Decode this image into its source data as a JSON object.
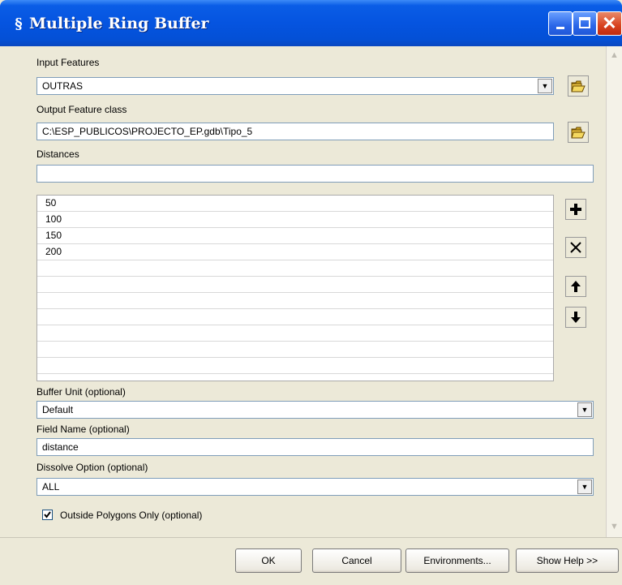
{
  "window": {
    "title": "Multiple Ring Buffer"
  },
  "form": {
    "input_features": {
      "label": "Input Features",
      "value": "OUTRAS"
    },
    "output_feature_class": {
      "label": "Output Feature class",
      "value": "C:\\ESP_PUBLICOS\\PROJECTO_EP.gdb\\Tipo_5"
    },
    "distances": {
      "label": "Distances",
      "value": "",
      "items": [
        "50",
        "100",
        "150",
        "200",
        "",
        "",
        "",
        "",
        "",
        "",
        ""
      ]
    },
    "buffer_unit": {
      "label": "Buffer Unit (optional)",
      "value": "Default"
    },
    "field_name": {
      "label": "Field Name (optional)",
      "value": "distance"
    },
    "dissolve_option": {
      "label": "Dissolve Option (optional)",
      "value": "ALL"
    },
    "outside_polygons": {
      "label": "Outside Polygons Only (optional)",
      "checked": true
    }
  },
  "buttons": {
    "ok": "OK",
    "cancel": "Cancel",
    "environments": "Environments...",
    "show_help": "Show Help >>"
  },
  "icons": {
    "app": "toolbox-script-icon",
    "folder": "open-folder-icon",
    "add": "plus-icon",
    "remove": "x-icon",
    "up": "arrow-up-icon",
    "down": "arrow-down-icon"
  }
}
